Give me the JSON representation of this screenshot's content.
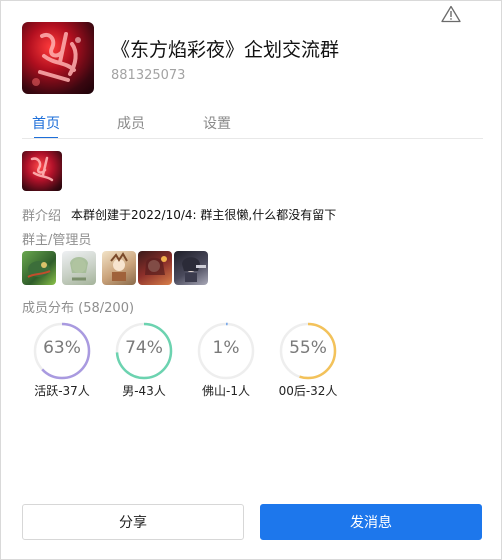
{
  "group": {
    "name": "《东方焰彩夜》企划交流群",
    "id": "881325073"
  },
  "tabs": [
    {
      "label": "首页",
      "active": true
    },
    {
      "label": "成员",
      "active": false
    },
    {
      "label": "设置",
      "active": false
    }
  ],
  "intro": {
    "label": "群介绍",
    "text": "本群创建于2022/10/4:  群主很懒,什么都没有留下"
  },
  "admins": {
    "label": "群主/管理员",
    "count": 5
  },
  "distribution": {
    "label": "成员分布",
    "count_text": "(58/200)",
    "stats": [
      {
        "percent": 63,
        "percent_text": "63%",
        "label": "活跃-37人",
        "color": "#a99ae0"
      },
      {
        "percent": 74,
        "percent_text": "74%",
        "label": "男-43人",
        "color": "#6cd3b0"
      },
      {
        "percent": 1,
        "percent_text": "1%",
        "label": "佛山-1人",
        "color": "#7aa9ea"
      },
      {
        "percent": 55,
        "percent_text": "55%",
        "label": "00后-32人",
        "color": "#f3c25a"
      }
    ]
  },
  "buttons": {
    "share": "分享",
    "send": "发消息"
  },
  "icons": {
    "warning": "warning-triangle-icon"
  },
  "colors": {
    "accent": "#1e6fd9",
    "primary_button": "#1d77ec"
  }
}
